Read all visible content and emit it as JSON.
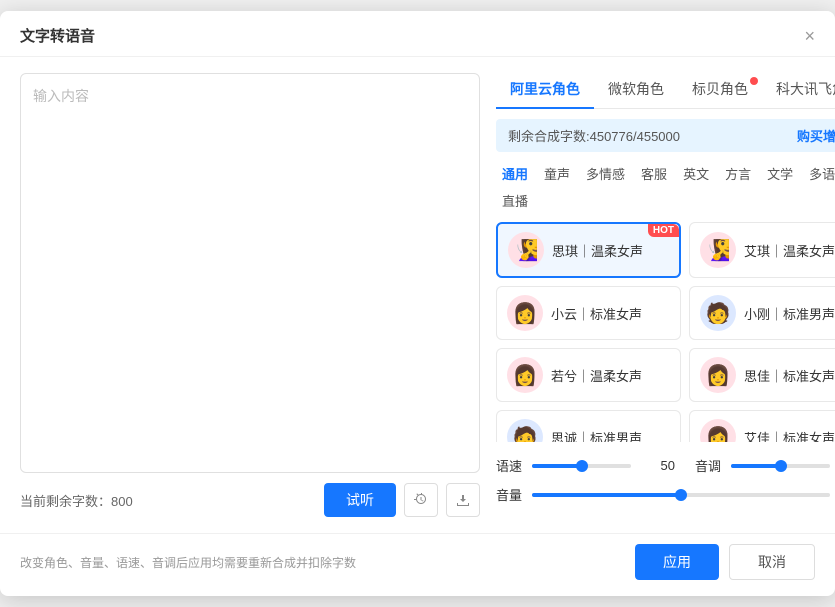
{
  "dialog": {
    "title": "文字转语音",
    "close_label": "×"
  },
  "tabs": [
    {
      "label": "阿里云角色",
      "active": true,
      "badge": false
    },
    {
      "label": "微软角色",
      "active": false,
      "badge": false
    },
    {
      "label": "标贝角色",
      "active": false,
      "badge": true
    },
    {
      "label": "科大讯飞角色",
      "active": false,
      "badge": false
    }
  ],
  "quota": {
    "text": "剩余合成字数:450776/455000",
    "link": "购买增值包"
  },
  "categories": [
    {
      "label": "通用",
      "active": true
    },
    {
      "label": "童声",
      "active": false
    },
    {
      "label": "多情感",
      "active": false
    },
    {
      "label": "客服",
      "active": false
    },
    {
      "label": "英文",
      "active": false
    },
    {
      "label": "方言",
      "active": false
    },
    {
      "label": "文学",
      "active": false
    },
    {
      "label": "多语种",
      "active": false
    },
    {
      "label": "直播",
      "active": false
    }
  ],
  "voices": [
    {
      "name": "思琪｜温柔女声",
      "hot": true,
      "selected": true,
      "gender": "female"
    },
    {
      "name": "艾琪｜温柔女声",
      "hot": true,
      "selected": false,
      "gender": "female"
    },
    {
      "name": "小云｜标准女声",
      "hot": false,
      "selected": false,
      "gender": "female"
    },
    {
      "name": "小刚｜标准男声",
      "hot": false,
      "selected": false,
      "gender": "male"
    },
    {
      "name": "若兮｜温柔女声",
      "hot": false,
      "selected": false,
      "gender": "female"
    },
    {
      "name": "思佳｜标准女声",
      "hot": false,
      "selected": false,
      "gender": "female"
    },
    {
      "name": "思诚｜标准男声",
      "hot": false,
      "selected": false,
      "gender": "male"
    },
    {
      "name": "艾佳｜标准女声",
      "hot": false,
      "selected": false,
      "gender": "female"
    }
  ],
  "sliders": {
    "speed": {
      "label": "语速",
      "value": 50.0,
      "percent": 50
    },
    "pitch": {
      "label": "音调",
      "value": 50.0,
      "percent": 50
    },
    "volume": {
      "label": "音量",
      "value": 50.0,
      "percent": 50
    }
  },
  "textarea": {
    "placeholder": "输入内容"
  },
  "remaining": {
    "label": "当前剩余字数：",
    "value": "800"
  },
  "buttons": {
    "preview": "试听",
    "apply": "应用",
    "cancel": "取消"
  },
  "footer_hint": "改变角色、音量、语速、音调后应用均需要重新合成并扣除字数"
}
